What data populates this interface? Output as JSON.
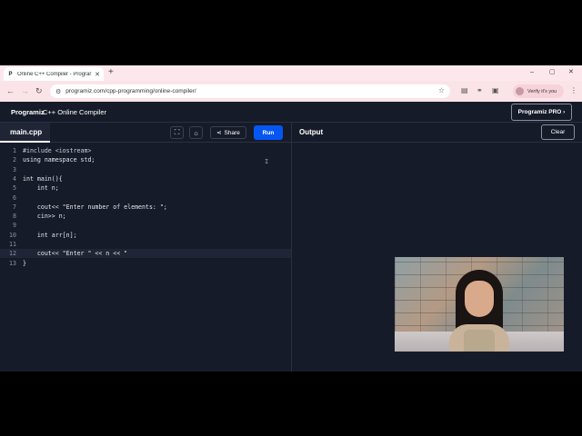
{
  "browser": {
    "tab_title": "Online C++ Compiler - Prograr",
    "tab_favicon": "P",
    "tab_close": "✕",
    "new_tab": "+",
    "url": "programiz.com/cpp-programming/online-compiler/",
    "profile_label": "Verify it's you",
    "window_controls": {
      "minimize": "–",
      "maximize": "▢",
      "close": "✕"
    },
    "nav": {
      "back": "←",
      "forward": "→",
      "reload": "↻"
    }
  },
  "app": {
    "logo_text": "Programiz",
    "title": "C++ Online Compiler",
    "pro_button": "Programiz PRO ›"
  },
  "editor": {
    "file_tab": "main.cpp",
    "share_label": "Share",
    "run_label": "Run",
    "lines": [
      {
        "n": "1",
        "text": "#include <iostream>"
      },
      {
        "n": "2",
        "text": "using namespace std;"
      },
      {
        "n": "3",
        "text": ""
      },
      {
        "n": "4",
        "text": "int main(){"
      },
      {
        "n": "5",
        "text": "    int n;"
      },
      {
        "n": "6",
        "text": ""
      },
      {
        "n": "7",
        "text": "    cout<< \"Enter number of elements: \";"
      },
      {
        "n": "8",
        "text": "    cin>> n;"
      },
      {
        "n": "9",
        "text": ""
      },
      {
        "n": "10",
        "text": "    int arr[n];"
      },
      {
        "n": "11",
        "text": ""
      },
      {
        "n": "12",
        "text": "    cout<< \"Enter \" << n << \""
      },
      {
        "n": "13",
        "text": "}"
      }
    ]
  },
  "output": {
    "label": "Output",
    "clear_label": "Clear"
  },
  "colors": {
    "background": "#161b29",
    "run_button": "#0556f3",
    "chrome": "#fce8ec"
  }
}
